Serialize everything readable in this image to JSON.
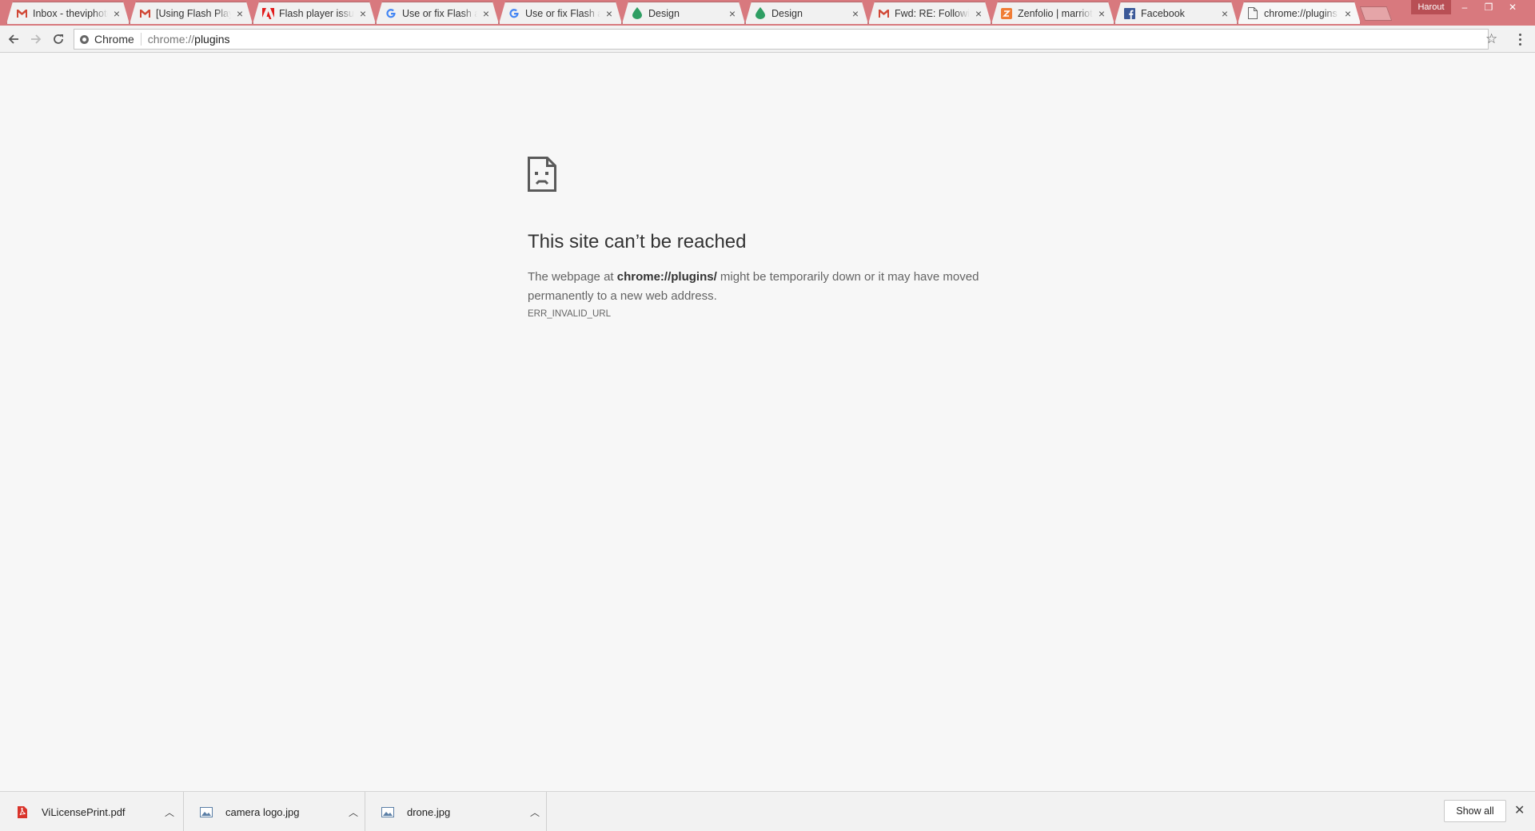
{
  "browser": {
    "profile_name": "Harout",
    "tabs": [
      {
        "title": "Inbox - theviphoto",
        "icon": "gmail-icon",
        "active": false
      },
      {
        "title": "[Using Flash Player",
        "icon": "gmail-icon",
        "active": false
      },
      {
        "title": "Flash player issue",
        "icon": "adobe-icon",
        "active": false
      },
      {
        "title": "Use or fix Flash a",
        "icon": "google-icon",
        "active": false
      },
      {
        "title": "Use or fix Flash a",
        "icon": "google-icon",
        "active": false
      },
      {
        "title": "Design",
        "icon": "drop-icon",
        "active": false
      },
      {
        "title": "Design",
        "icon": "drop-icon",
        "active": false
      },
      {
        "title": "Fwd: RE: Followin",
        "icon": "gmail-icon",
        "active": false
      },
      {
        "title": "Zenfolio | marriot",
        "icon": "zenfolio-icon",
        "active": false
      },
      {
        "title": "Facebook",
        "icon": "facebook-icon",
        "active": false
      },
      {
        "title": "chrome://plugins",
        "icon": "page-icon",
        "active": true
      }
    ],
    "omnibox": {
      "chip_label": "Chrome",
      "url_scheme": "chrome://",
      "url_host": "plugins"
    }
  },
  "error_page": {
    "title": "This site can’t be reached",
    "message_prefix": "The webpage at ",
    "message_host": "chrome://plugins/",
    "message_suffix": " might be temporarily down or it may have moved permanently to a new web address.",
    "error_code": "ERR_INVALID_URL"
  },
  "downloads": {
    "items": [
      {
        "name": "ViLicensePrint.pdf",
        "icon": "pdf-icon"
      },
      {
        "name": "camera logo.jpg",
        "icon": "image-icon"
      },
      {
        "name": "drone.jpg",
        "icon": "image-icon"
      }
    ],
    "show_all_label": "Show all"
  },
  "colors": {
    "tabstrip": "#d8797e",
    "gmail_red": "#d14836",
    "google_blue": "#4285f4",
    "drop_green": "#2e9e63",
    "zenfolio_orange": "#f07c35",
    "facebook_blue": "#3b5998"
  }
}
